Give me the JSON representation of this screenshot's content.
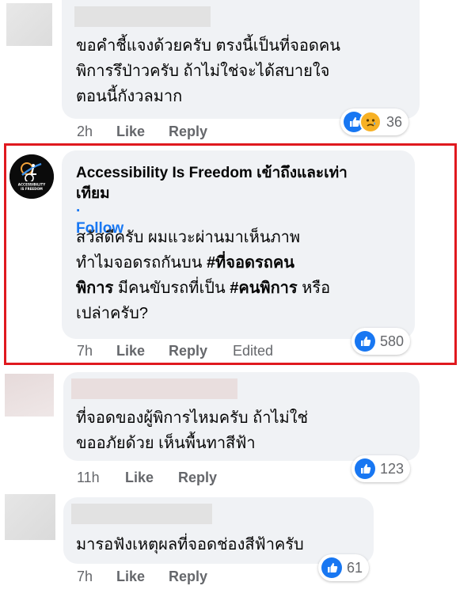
{
  "comments": [
    {
      "text": "ขอคำชี้แจงด้วยครับ ตรงนี้เป็นที่จอดคน\nพิการรึป่าวครับ ถ้าไม่ใช่จะได้สบายใจ\nตอนนี้กังวลมาก",
      "time": "2h",
      "like_label": "Like",
      "reply_label": "Reply",
      "reaction_count": "36",
      "reactions": [
        "like-icon",
        "sad-icon"
      ]
    },
    {
      "author": "Accessibility Is Freedom เข้าถึงและเท่า\nเทียม",
      "follow_label": "· Follow",
      "avatar_text": "ACCESSIBILITY IS FREEDOM",
      "text_line1": "สวัสดีครับ ผมแวะผ่านมาเห็นภาพ",
      "text_line2_pre": "ทำไมจอดรถกันบน ",
      "hashtag1_line2": "#ที่จอดรถคน",
      "hashtag1_line3": "พิการ",
      "text_line3_mid": " มีคนขับรถที่เป็น ",
      "hashtag2": "#คนพิการ",
      "text_line3_post": " หรือ",
      "text_line4": "เปล่าครับ?",
      "time": "7h",
      "like_label": "Like",
      "reply_label": "Reply",
      "edited_label": "Edited",
      "reaction_count": "580",
      "reactions": [
        "like-icon"
      ]
    },
    {
      "text": "ที่จอดของผู้พิการไหมครับ ถ้าไม่ใช่\nขออภัยด้วย เห็นพื้นทาสีฟ้า",
      "time": "11h",
      "like_label": "Like",
      "reply_label": "Reply",
      "reaction_count": "123",
      "reactions": [
        "like-icon"
      ]
    },
    {
      "text": "มารอฟังเหตุผลที่จอดช่องสีฟ้าครับ",
      "time": "7h",
      "like_label": "Like",
      "reply_label": "Reply",
      "reaction_count": "61",
      "reactions": [
        "like-icon"
      ]
    }
  ],
  "colors": {
    "highlight": "#e0191f",
    "link": "#1877f2",
    "bubble": "#f0f2f5",
    "meta": "#65676b"
  }
}
